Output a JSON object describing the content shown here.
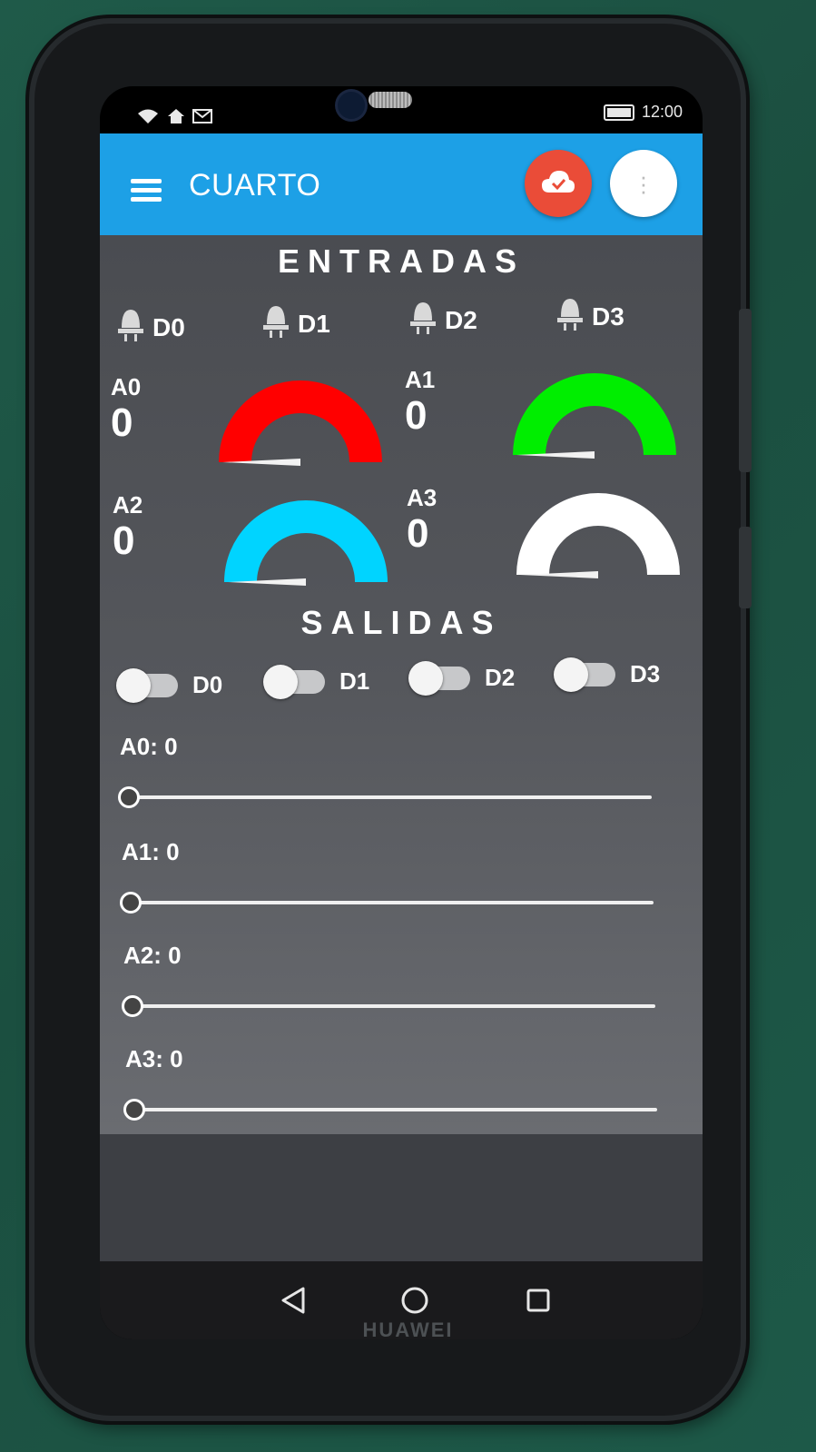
{
  "statusbar": {
    "time": "12:00"
  },
  "appbar": {
    "title": "CUARTO"
  },
  "inputs": {
    "section_title": "ENTRADAS",
    "digital": [
      {
        "label": "D0"
      },
      {
        "label": "D1"
      },
      {
        "label": "D2"
      },
      {
        "label": "D3"
      }
    ],
    "analog": [
      {
        "label": "A0",
        "value": "0",
        "color": "#ff0000",
        "level": 0
      },
      {
        "label": "A1",
        "value": "0",
        "color": "#00ee00",
        "level": 0
      },
      {
        "label": "A2",
        "value": "0",
        "color": "#00d4ff",
        "level": 0
      },
      {
        "label": "A3",
        "value": "0",
        "color": "#ffffff",
        "level": 0
      }
    ]
  },
  "outputs": {
    "section_title": "SALIDAS",
    "switches": [
      {
        "label": "D0",
        "on": false
      },
      {
        "label": "D1",
        "on": false
      },
      {
        "label": "D2",
        "on": false
      },
      {
        "label": "D3",
        "on": false
      }
    ],
    "sliders": [
      {
        "label": "A0: 0",
        "value": 0
      },
      {
        "label": "A1: 0",
        "value": 0
      },
      {
        "label": "A2: 0",
        "value": 0
      },
      {
        "label": "A3: 0",
        "value": 0
      }
    ]
  },
  "icons": {
    "menu": "hamburger-icon",
    "cloud": "cloud-check-icon",
    "more": "more-vert-icon",
    "digital_input": "lightbulb-icon",
    "back": "back-triangle-icon",
    "home": "home-circle-icon",
    "recents": "recents-square-icon"
  },
  "colors": {
    "appbar": "#1da0e6",
    "cloud_button": "#ea4c38",
    "content_bg": "#55575c"
  },
  "device": {
    "brand": "HUAWEI"
  }
}
